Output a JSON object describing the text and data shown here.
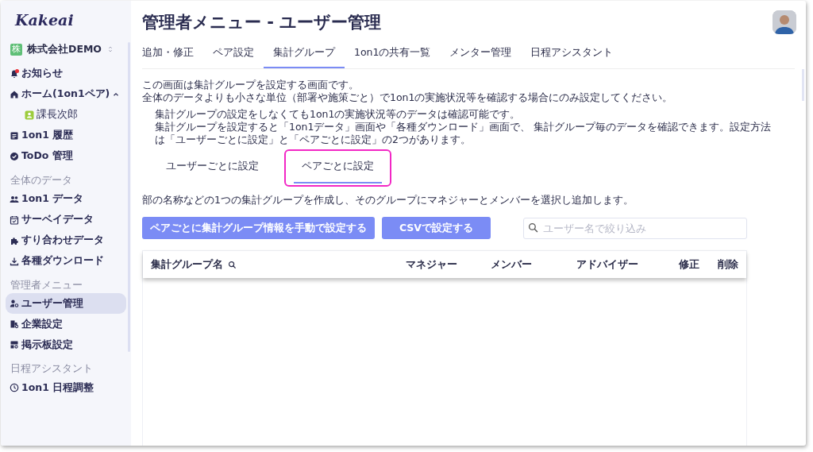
{
  "logo": "Kakeai",
  "company": {
    "badge": "株",
    "name": "株式会社DEMO"
  },
  "sidebar": {
    "sections": [
      {
        "items": [
          {
            "label": "お知らせ",
            "selected": false,
            "unread": true
          },
          {
            "label": "ホーム(1on1ペア)",
            "selected": false,
            "unread": false,
            "expanded": true,
            "children": [
              {
                "label": "課長次郎",
                "selected": false
              }
            ]
          },
          {
            "label": "1on1 履歴",
            "selected": false,
            "unread": false
          },
          {
            "label": "ToDo 管理",
            "selected": false,
            "unread": false
          }
        ]
      },
      {
        "heading": "全体のデータ",
        "items": [
          {
            "label": "1on1 データ",
            "selected": false
          },
          {
            "label": "サーベイデータ",
            "selected": false
          },
          {
            "label": "すり合わせデータ",
            "selected": false
          },
          {
            "label": "各種ダウンロード",
            "selected": false
          }
        ]
      },
      {
        "heading": "管理者メニュー",
        "items": [
          {
            "label": "ユーザー管理",
            "selected": true
          },
          {
            "label": "企業設定",
            "selected": false
          },
          {
            "label": "掲示板設定",
            "selected": false
          }
        ]
      },
      {
        "heading": "日程アシスタント",
        "items": [
          {
            "label": "1on1 日程調整",
            "selected": false
          }
        ]
      }
    ]
  },
  "page_title": "管理者メニュー - ユーザー管理",
  "tabs": [
    {
      "label": "追加・修正",
      "selected": false
    },
    {
      "label": "ペア設定",
      "selected": false
    },
    {
      "label": "集計グループ",
      "selected": true
    },
    {
      "label": "1on1の共有一覧",
      "selected": false
    },
    {
      "label": "メンター管理",
      "selected": false
    },
    {
      "label": "日程アシスタント",
      "selected": false
    }
  ],
  "intro": [
    "この画面は集計グループを設定する画面です。",
    "全体のデータよりも小さな単位（部署や施策ごと）で1on1の実施状況等を確認する場合にのみ設定してください。"
  ],
  "notes": [
    "集計グループの設定をしなくても1on1の実施状況等のデータは確認可能です。",
    "集計グループを設定すると「1on1データ」画面や「各種ダウンロード」画面で、 集計グループ毎のデータを確認できます。設定方法は「ユーザーごとに設定」と「ペアごとに設定」の2つがあります。"
  ],
  "sub_tabs": [
    {
      "label": "ユーザーごとに設定",
      "selected": false,
      "highlighted": false
    },
    {
      "label": "ペアごとに設定",
      "selected": true,
      "highlighted": true
    }
  ],
  "description": "部の名称などの1つの集計グループを作成し、そのグループにマネジャーとメンバーを選択し追加します。",
  "buttons": [
    "ペアごとに集計グループ情報を手動で設定する",
    "CSVで設定する"
  ],
  "search": {
    "placeholder": "ユーザー名で絞り込み"
  },
  "table": {
    "columns": [
      {
        "label": "集計グループ名",
        "searchable": true
      },
      {
        "label": "マネジャー",
        "searchable": false
      },
      {
        "label": "メンバー",
        "searchable": false
      },
      {
        "label": "アドバイザー",
        "searchable": false
      },
      {
        "label": "修正",
        "searchable": false
      },
      {
        "label": "削除",
        "searchable": false
      }
    ]
  }
}
